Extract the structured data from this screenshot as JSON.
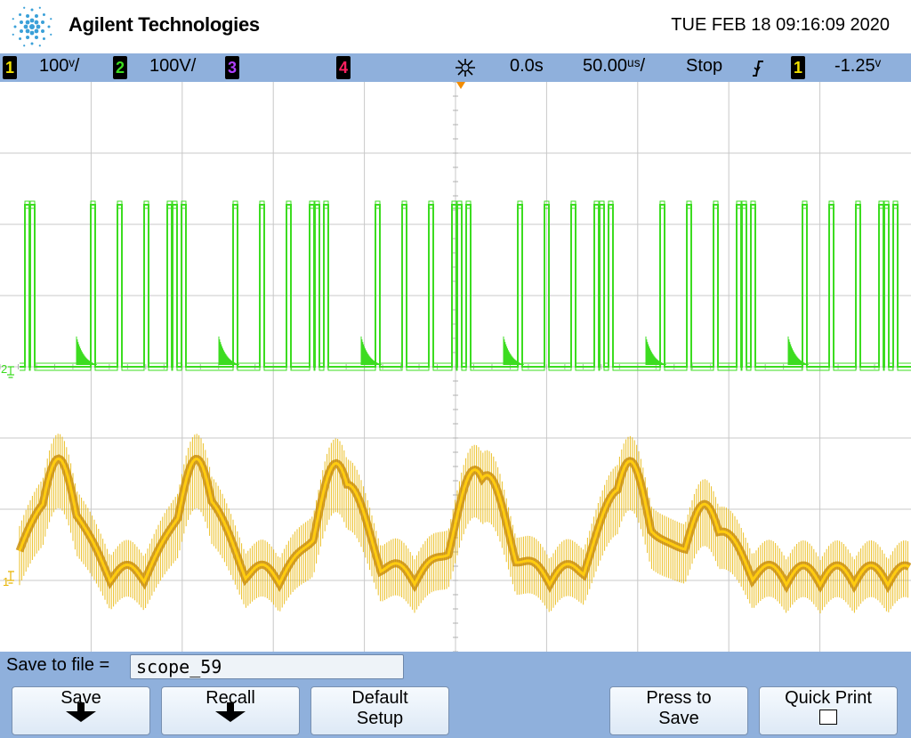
{
  "header": {
    "brand": "Agilent Technologies",
    "datetime": "TUE FEB 18 09:16:09 2020"
  },
  "status": {
    "ch1": {
      "num": "1",
      "scale": "100ᵛ/"
    },
    "ch2": {
      "num": "2",
      "scale": "100V/"
    },
    "ch3": {
      "num": "3"
    },
    "ch4": {
      "num": "4"
    },
    "delay": "0.0s",
    "timebase": "50.00ᵘˢ/",
    "run_state": "Stop",
    "trigger_slope_icon": "falling-edge-icon",
    "trigger_source": "1",
    "trigger_level": "-1.25ᵛ"
  },
  "markers": {
    "ch1_ground": "1",
    "ch2_ground": "2"
  },
  "softkeys": {
    "save_to_file_label": "Save to file =",
    "filename": "scope_59",
    "save": "Save",
    "recall": "Recall",
    "default_line1": "Default",
    "default_line2": "Setup",
    "press_line1": "Press to",
    "press_line2": "Save",
    "quick_print": "Quick Print"
  },
  "colors": {
    "ch1": "#e8b400",
    "ch2": "#3cdc20",
    "statusbar": "#8fb0dc",
    "trigger_marker": "#f28c00"
  }
}
